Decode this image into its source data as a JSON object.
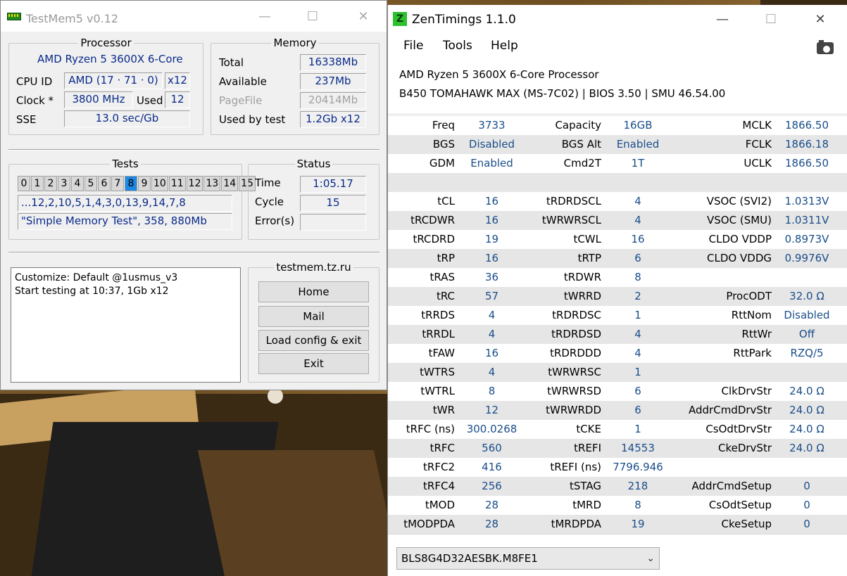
{
  "testmem": {
    "title": "TestMem5 v0.12",
    "processor": {
      "caption": "Processor",
      "name": "AMD Ryzen 5 3600X 6-Core",
      "cpuid_label": "CPU ID",
      "cpuid_value": "AMD  (17 · 71 · 0)",
      "threads": "x12",
      "clock_label": "Clock *",
      "clock_value": "3800 MHz",
      "used_label": "Used",
      "used_value": "12",
      "sse_label": "SSE",
      "sse_value": "13.0 sec/Gb"
    },
    "memory": {
      "caption": "Memory",
      "total_label": "Total",
      "total_value": "16338Mb",
      "available_label": "Available",
      "available_value": "237Mb",
      "pagefile_label": "PageFile",
      "pagefile_value": "20414Mb",
      "usedby_label": "Used by test",
      "usedby_value": "1.2Gb x12"
    },
    "tests": {
      "caption": "Tests",
      "cells": [
        "0",
        "1",
        "2",
        "3",
        "4",
        "5",
        "6",
        "7",
        "8",
        "9",
        "10",
        "11",
        "12",
        "13",
        "14",
        "15"
      ],
      "active_cell": "8",
      "order": "...12,2,10,5,1,4,3,0,13,9,14,7,8",
      "current": "\"Simple Memory Test\", 358, 880Mb"
    },
    "status": {
      "caption": "Status",
      "time_label": "Time",
      "time_value": "1:05.17",
      "cycle_label": "Cycle",
      "cycle_value": "15",
      "errors_label": "Error(s)",
      "errors_value": ""
    },
    "log": "Customize: Default @1usmus_v3\nStart testing at 10:37, 1Gb x12",
    "links": {
      "caption": "testmem.tz.ru",
      "home": "Home",
      "mail": "Mail",
      "load": "Load config & exit",
      "exit": "Exit"
    },
    "icon": "ram-stick-icon"
  },
  "zentimings": {
    "title": "ZenTimings 1.1.0",
    "icon_letter": "Z",
    "menu": [
      "File",
      "Tools",
      "Help"
    ],
    "cpu": "AMD Ryzen 5 3600X 6-Core Processor",
    "board": "B450 TOMAHAWK MAX (MS-7C02) | BIOS 3.50 | SMU 46.54.00",
    "rows": [
      {
        "k1": "Freq",
        "v1": "3733",
        "k2": "Capacity",
        "v2": "16GB",
        "k3": "MCLK",
        "v3": "1866.50"
      },
      {
        "k1": "BGS",
        "v1": "Disabled",
        "k2": "BGS Alt",
        "v2": "Enabled",
        "k3": "FCLK",
        "v3": "1866.18"
      },
      {
        "k1": "GDM",
        "v1": "Enabled",
        "k2": "Cmd2T",
        "v2": "1T",
        "k3": "UCLK",
        "v3": "1866.50"
      },
      {
        "k1": "",
        "v1": "",
        "k2": "",
        "v2": "",
        "k3": "",
        "v3": ""
      },
      {
        "k1": "tCL",
        "v1": "16",
        "k2": "tRDRDSCL",
        "v2": "4",
        "k3": "VSOC (SVI2)",
        "v3": "1.0313V"
      },
      {
        "k1": "tRCDWR",
        "v1": "16",
        "k2": "tWRWRSCL",
        "v2": "4",
        "k3": "VSOC (SMU)",
        "v3": "1.0311V"
      },
      {
        "k1": "tRCDRD",
        "v1": "19",
        "k2": "tCWL",
        "v2": "16",
        "k3": "CLDO VDDP",
        "v3": "0.8973V"
      },
      {
        "k1": "tRP",
        "v1": "16",
        "k2": "tRTP",
        "v2": "6",
        "k3": "CLDO VDDG",
        "v3": "0.9976V"
      },
      {
        "k1": "tRAS",
        "v1": "36",
        "k2": "tRDWR",
        "v2": "8",
        "k3": "",
        "v3": ""
      },
      {
        "k1": "tRC",
        "v1": "57",
        "k2": "tWRRD",
        "v2": "2",
        "k3": "ProcODT",
        "v3": "32.0 Ω"
      },
      {
        "k1": "tRRDS",
        "v1": "4",
        "k2": "tRDRDSC",
        "v2": "1",
        "k3": "RttNom",
        "v3": "Disabled"
      },
      {
        "k1": "tRRDL",
        "v1": "4",
        "k2": "tRDRDSD",
        "v2": "4",
        "k3": "RttWr",
        "v3": "Off"
      },
      {
        "k1": "tFAW",
        "v1": "16",
        "k2": "tRDRDDD",
        "v2": "4",
        "k3": "RttPark",
        "v3": "RZQ/5"
      },
      {
        "k1": "tWTRS",
        "v1": "4",
        "k2": "tWRWRSC",
        "v2": "1",
        "k3": "",
        "v3": ""
      },
      {
        "k1": "tWTRL",
        "v1": "8",
        "k2": "tWRWRSD",
        "v2": "6",
        "k3": "ClkDrvStr",
        "v3": "24.0 Ω"
      },
      {
        "k1": "tWR",
        "v1": "12",
        "k2": "tWRWRDD",
        "v2": "6",
        "k3": "AddrCmdDrvStr",
        "v3": "24.0 Ω"
      },
      {
        "k1": "tRFC (ns)",
        "v1": "300.0268",
        "k2": "tCKE",
        "v2": "1",
        "k3": "CsOdtDrvStr",
        "v3": "24.0 Ω"
      },
      {
        "k1": "tRFC",
        "v1": "560",
        "k2": "tREFI",
        "v2": "14553",
        "k3": "CkeDrvStr",
        "v3": "24.0 Ω"
      },
      {
        "k1": "tRFC2",
        "v1": "416",
        "k2": "tREFI (ns)",
        "v2": "7796.946",
        "k3": "",
        "v3": ""
      },
      {
        "k1": "tRFC4",
        "v1": "256",
        "k2": "tSTAG",
        "v2": "218",
        "k3": "AddrCmdSetup",
        "v3": "0"
      },
      {
        "k1": "tMOD",
        "v1": "28",
        "k2": "tMRD",
        "v2": "8",
        "k3": "CsOdtSetup",
        "v3": "0"
      },
      {
        "k1": "tMODPDA",
        "v1": "28",
        "k2": "tMRDPDA",
        "v2": "19",
        "k3": "CkeSetup",
        "v3": "0"
      }
    ],
    "module": "BLS8G4D32AESBK.M8FE1",
    "icons": {
      "camera": "camera-icon",
      "dropdown": "chevron-down-icon"
    }
  }
}
